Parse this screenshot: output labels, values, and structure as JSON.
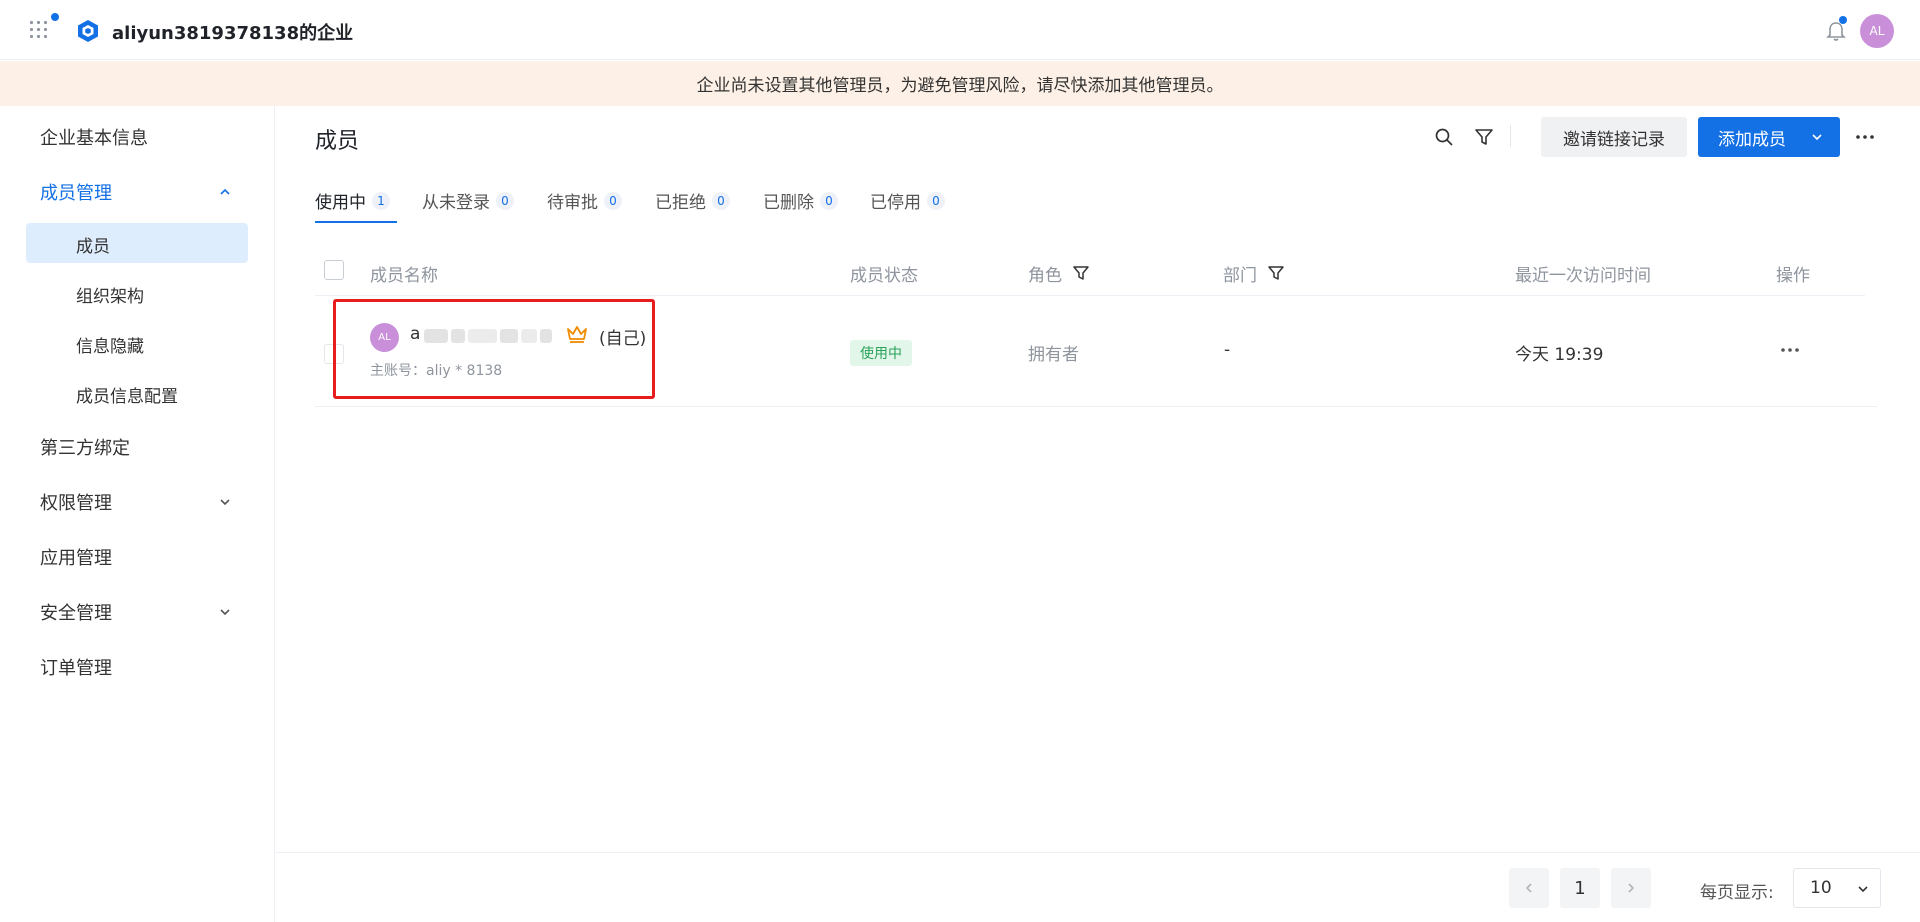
{
  "header": {
    "org_name": "aliyun3819378138的企业",
    "avatar_initials": "AL"
  },
  "banner": {
    "text": "企业尚未设置其他管理员，为避免管理风险，请尽快添加其他管理员。"
  },
  "sidebar": {
    "items": [
      {
        "label": "企业基本信息"
      },
      {
        "label": "成员管理",
        "expanded": true
      },
      {
        "label": "第三方绑定"
      },
      {
        "label": "权限管理"
      },
      {
        "label": "应用管理"
      },
      {
        "label": "安全管理"
      },
      {
        "label": "订单管理"
      }
    ],
    "sub_items": [
      {
        "label": "成员",
        "selected": true
      },
      {
        "label": "组织架构"
      },
      {
        "label": "信息隐藏"
      },
      {
        "label": "成员信息配置"
      }
    ]
  },
  "main": {
    "title": "成员",
    "invite_button": "邀请链接记录",
    "add_button": "添加成员",
    "tabs": [
      {
        "label": "使用中",
        "count": "1"
      },
      {
        "label": "从未登录",
        "count": "0"
      },
      {
        "label": "待审批",
        "count": "0"
      },
      {
        "label": "已拒绝",
        "count": "0"
      },
      {
        "label": "已删除",
        "count": "0"
      },
      {
        "label": "已停用",
        "count": "0"
      }
    ],
    "columns": [
      "成员名称",
      "成员状态",
      "角色",
      "部门",
      "最近一次访问时间",
      "操作"
    ],
    "rows": [
      {
        "avatar": "AL",
        "name_first_char": "a",
        "self_tag": "(自己)",
        "sub_account": "主账号：aliy * 8138",
        "status": "使用中",
        "role": "拥有者",
        "department": "-",
        "last_visit": "今天 19:39"
      }
    ]
  },
  "pagination": {
    "current_page": "1",
    "per_page_label": "每页显示:",
    "per_page_value": "10"
  },
  "colors": {
    "primary": "#1370e5",
    "banner_bg": "#fdf0e6",
    "status_green": "#2aa35a",
    "avatar": "#c990d9",
    "highlight": "#e81c1c"
  }
}
